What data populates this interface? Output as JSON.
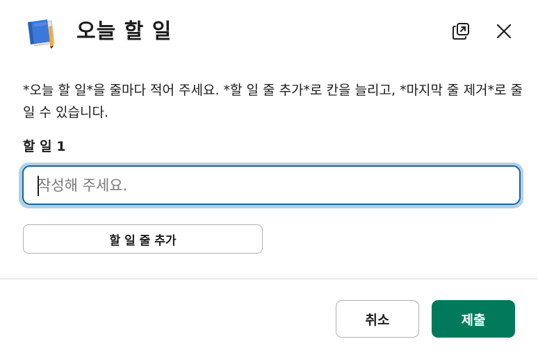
{
  "modal": {
    "title": "오늘 할 일",
    "icons": {
      "title_icon": "blue-book-icon",
      "popout": "popout-window-icon",
      "close": "close-icon"
    }
  },
  "description": "*오늘 할 일*을 줄마다 적어 주세요. *할 일 줄 추가*로 칸을 늘리고, *마지막 줄 제거*로 줄일 수 있습니다.",
  "field": {
    "label": "할 일 1",
    "placeholder": "작성해 주세요.",
    "value": ""
  },
  "add_row_label": "할 일 줄 추가",
  "footer": {
    "cancel_label": "취소",
    "submit_label": "제출"
  },
  "colors": {
    "primary": "#007a5a",
    "focus_border": "#1264a3",
    "focus_ring": "#b4d0e6"
  }
}
